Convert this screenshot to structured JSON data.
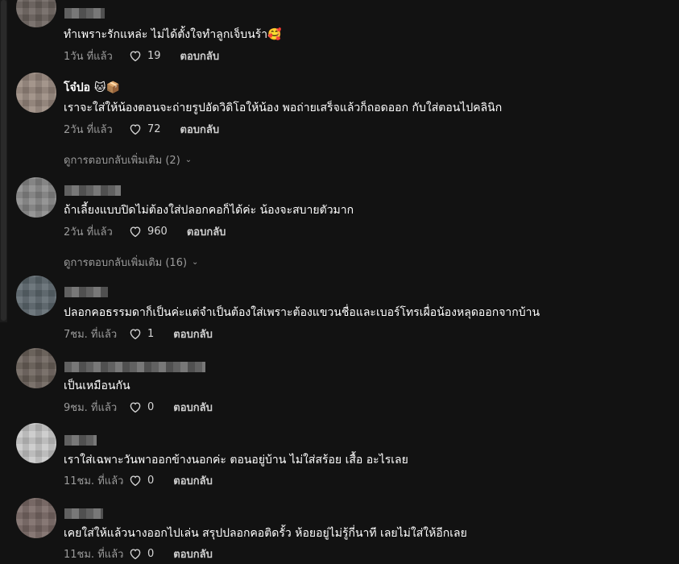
{
  "comments": [
    {
      "username": "",
      "text": "ทำเพราะรักแหล่ะ ไม่ได้ตั้งใจทำลูกเจ็บนร้า🥰",
      "time": "1วัน ที่แล้ว",
      "likes": "19",
      "reply_label": "ตอบกลับ",
      "avatar_color": "#6e6560"
    },
    {
      "username": "โจ๋ปอ 🐱📦",
      "text": "เราจะใส่ให้น้องตอนจะถ่ายรูปอัดวิดิโอให้น้อง พอถ่ายเสร็จแล้วก็ถอดออก กับใส่ตอนไปคลินิก",
      "time": "2วัน ที่แล้ว",
      "likes": "72",
      "reply_label": "ตอบกลับ",
      "avatar_color": "#9a8a80",
      "view_more": "ดูการตอบกลับเพิ่มเติม (2)"
    },
    {
      "username": "",
      "text": "ถ้าเลี้ยงแบบปิดไม่ต้องใส่ปลอกคอก็ได้ค่ะ น้องจะสบายตัวมาก",
      "time": "2วัน ที่แล้ว",
      "likes": "960",
      "reply_label": "ตอบกลับ",
      "avatar_color": "#8a8a8a",
      "view_more": "ดูการตอบกลับเพิ่มเติม (16)"
    },
    {
      "username": "",
      "text": "ปลอกคอธรรมดาก็เป็นค่ะแต่จำเป็นต้องใส่เพราะต้องแขวนชื่อและเบอร์โทรเผื่อน้องหลุดออกจากบ้าน",
      "time": "7ชม. ที่แล้ว",
      "likes": "1",
      "reply_label": "ตอบกลับ",
      "avatar_color": "#5f6a70"
    },
    {
      "username": "",
      "text": "เป็นเหมือนกัน",
      "time": "9ชม. ที่แล้ว",
      "likes": "0",
      "reply_label": "ตอบกลับ",
      "avatar_color": "#6d635c"
    },
    {
      "username": "",
      "text": "เราใส่เฉพาะวันพาออกข้างนอกค่ะ ตอนอยู่บ้าน ไม่ใส่สร้อย เสื้อ อะไรเลย",
      "time": "11ชม. ที่แล้ว",
      "likes": "0",
      "reply_label": "ตอบกลับ",
      "avatar_color": "#c9c9c9"
    },
    {
      "username": "",
      "text": "เคยใส่ให้แล้วนางออกไปเล่น สรุปปลอกคอติดรั้ว ห้อยอยู่ไม่รู้กี่นาที เลยไม่ใส่ให้อีกเลย",
      "time": "11ชม. ที่แล้ว",
      "likes": "0",
      "reply_label": "ตอบกลับ",
      "avatar_color": "#7a6a66"
    }
  ],
  "colors": {
    "background": "#121212",
    "text": "#ffffff",
    "meta": "#9b9b9b"
  },
  "icons": {
    "like": "heart-outline-icon",
    "expand": "chevron-down-icon"
  }
}
